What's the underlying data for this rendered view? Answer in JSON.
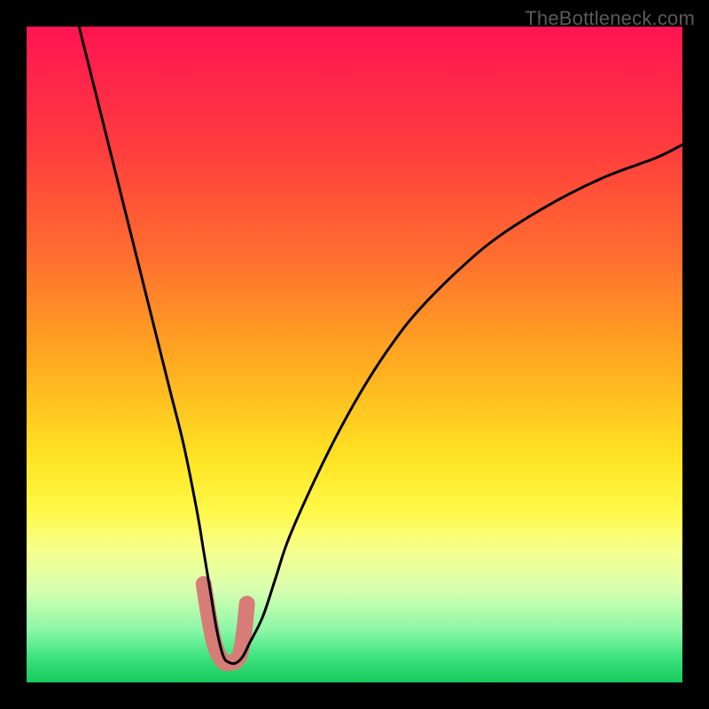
{
  "watermark": {
    "text": "TheBottleneck.com"
  },
  "chart_data": {
    "type": "line",
    "title": "",
    "xlabel": "",
    "ylabel": "",
    "xlim": [
      0,
      100
    ],
    "ylim": [
      0,
      100
    ],
    "grid": false,
    "legend": false,
    "background_gradient": {
      "stops": [
        {
          "pos": 0.0,
          "color": "#ff1452"
        },
        {
          "pos": 0.18,
          "color": "#ff3b3e"
        },
        {
          "pos": 0.35,
          "color": "#ff6e2f"
        },
        {
          "pos": 0.52,
          "color": "#ffae1f"
        },
        {
          "pos": 0.66,
          "color": "#ffe423"
        },
        {
          "pos": 0.74,
          "color": "#fff94a"
        },
        {
          "pos": 0.8,
          "color": "#f6ff8e"
        },
        {
          "pos": 0.86,
          "color": "#d6ffb0"
        },
        {
          "pos": 0.92,
          "color": "#8cf7a8"
        },
        {
          "pos": 0.96,
          "color": "#3fe47e"
        },
        {
          "pos": 1.0,
          "color": "#16c95d"
        }
      ]
    },
    "series": [
      {
        "name": "bottleneck-curve",
        "color": "#000000",
        "width": 3,
        "x": [
          8,
          10,
          12,
          14,
          16,
          18,
          20,
          22,
          24,
          26,
          27,
          28,
          29,
          30,
          31,
          32,
          33,
          34,
          36,
          38,
          40,
          44,
          48,
          52,
          56,
          60,
          66,
          72,
          80,
          88,
          96,
          100
        ],
        "values": [
          100,
          92,
          84,
          76,
          68,
          60,
          52,
          44,
          36,
          26,
          20,
          14,
          8,
          4,
          3,
          3,
          4,
          6,
          10,
          16,
          22,
          31,
          39,
          46,
          52,
          57,
          63,
          68,
          73,
          77,
          80,
          82
        ]
      },
      {
        "name": "highlight-band",
        "color": "#d77c76",
        "width": 18,
        "linecap": "round",
        "x": [
          27.0,
          27.8,
          28.6,
          29.4,
          30.2,
          31.0,
          31.8,
          32.6,
          33.2,
          33.6
        ],
        "values": [
          15.0,
          10.0,
          6.0,
          4.0,
          3.0,
          3.0,
          3.2,
          4.5,
          8.0,
          12.0
        ]
      }
    ]
  }
}
